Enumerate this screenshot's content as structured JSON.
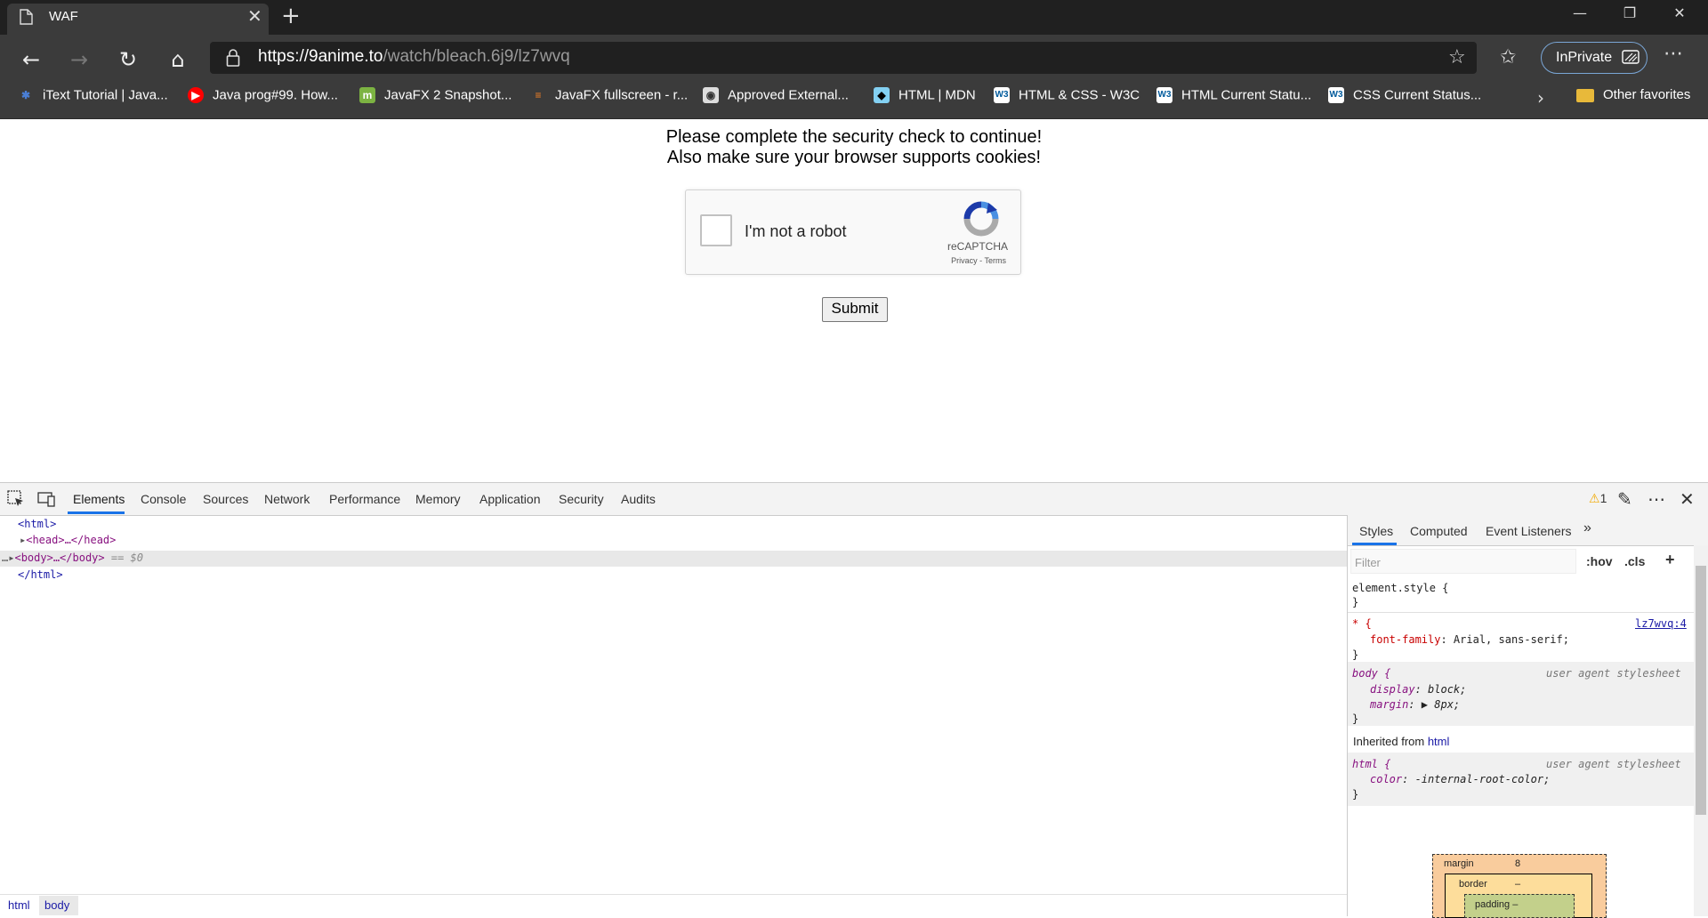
{
  "browser": {
    "tab_title": "WAF",
    "url_host": "https://9anime.to",
    "url_path": "/watch/bleach.6j9/lz7wvq",
    "inprivate_label": "InPrivate",
    "favorites": [
      {
        "label": "iText Tutorial | Java...",
        "icon": "itext-icon",
        "color": "#4a7fd6"
      },
      {
        "label": "Java prog#99. How...",
        "icon": "youtube-icon",
        "color": "#ff0000"
      },
      {
        "label": "JavaFX 2 Snapshot...",
        "icon": "m-icon",
        "color": "#7cb342"
      },
      {
        "label": "JavaFX fullscreen - r...",
        "icon": "stackoverflow-icon",
        "color": "#f48024"
      },
      {
        "label": "Approved External...",
        "icon": "camera-icon",
        "color": "#dddddd"
      },
      {
        "label": "HTML | MDN",
        "icon": "mdn-icon",
        "color": "#83d0f2"
      },
      {
        "label": "HTML & CSS - W3C",
        "icon": "w3c-icon",
        "color": "#005a9c"
      },
      {
        "label": "HTML Current Statu...",
        "icon": "w3c-icon",
        "color": "#005a9c"
      },
      {
        "label": "CSS Current Status...",
        "icon": "w3c-icon",
        "color": "#005a9c"
      }
    ],
    "other_favorites": "Other favorites"
  },
  "page": {
    "line1": "Please complete the security check to continue!",
    "line2": "Also make sure your browser supports cookies!",
    "recaptcha_label": "I'm not a robot",
    "recaptcha_brand": "reCAPTCHA",
    "recaptcha_links": "Privacy - Terms",
    "submit_label": "Submit"
  },
  "devtools": {
    "tabs": [
      "Elements",
      "Console",
      "Sources",
      "Network",
      "Performance",
      "Memory",
      "Application",
      "Security",
      "Audits"
    ],
    "warning_count": "1",
    "tree": {
      "html_open": "<html>",
      "head": "<head>…</head>",
      "body": "<body>…</body>",
      "body_suffix": " == $0",
      "html_close": "</html>"
    },
    "breadcrumbs": [
      "html",
      "body"
    ],
    "styles_tabs": [
      "Styles",
      "Computed",
      "Event Listeners"
    ],
    "filter_placeholder": "Filter",
    "hov": ":hov",
    "cls": ".cls",
    "rules": {
      "element_style": "element.style {",
      "close": "}",
      "star_selector": "* {",
      "star_source": "lz7wvq:4",
      "star_prop": "font-family",
      "star_value": ": Arial, sans-serif;",
      "body_selector": "body {",
      "ua_label": "user agent stylesheet",
      "body_prop1": "display",
      "body_val1": ": block;",
      "body_prop2": "margin",
      "body_val2": ": ▶ 8px;",
      "inherited_from": "Inherited from ",
      "inherited_el": "html",
      "html_selector": "html {",
      "html_prop": "color",
      "html_val": ": -internal-root-color;"
    },
    "box_model": {
      "margin_label": "margin",
      "margin_value": "8",
      "border_label": "border",
      "border_value": "–",
      "padding_label": "padding –"
    }
  }
}
